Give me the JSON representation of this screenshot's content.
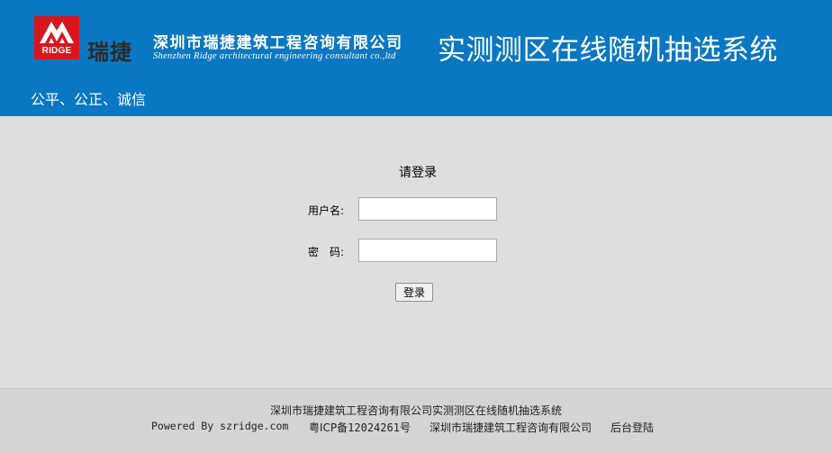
{
  "header": {
    "logo_text": "RIDGE",
    "logo_cn": "瑞捷",
    "company_cn": "深圳市瑞捷建筑工程咨询有限公司",
    "company_en": "Shenzhen Ridge architectural engineering consultant co.,ltd",
    "system_title": "实测测区在线随机抽选系统",
    "slogan": "公平、公正、诚信",
    "brand_color": "#0a77c2",
    "logo_color": "#d9161d"
  },
  "login": {
    "title": "请登录",
    "username_label": "用户名:",
    "username_value": "",
    "password_label": "密　码:",
    "password_value": "",
    "submit_label": "登录"
  },
  "footer": {
    "line1": "深圳市瑞捷建筑工程咨询有限公司实测测区在线随机抽选系统",
    "powered": "Powered By szridge.com",
    "icp_prefix": "粤ICP备",
    "icp_number": "12024261",
    "icp_suffix": "号",
    "company": "深圳市瑞捷建筑工程咨询有限公司",
    "admin_login": "后台登陆"
  }
}
